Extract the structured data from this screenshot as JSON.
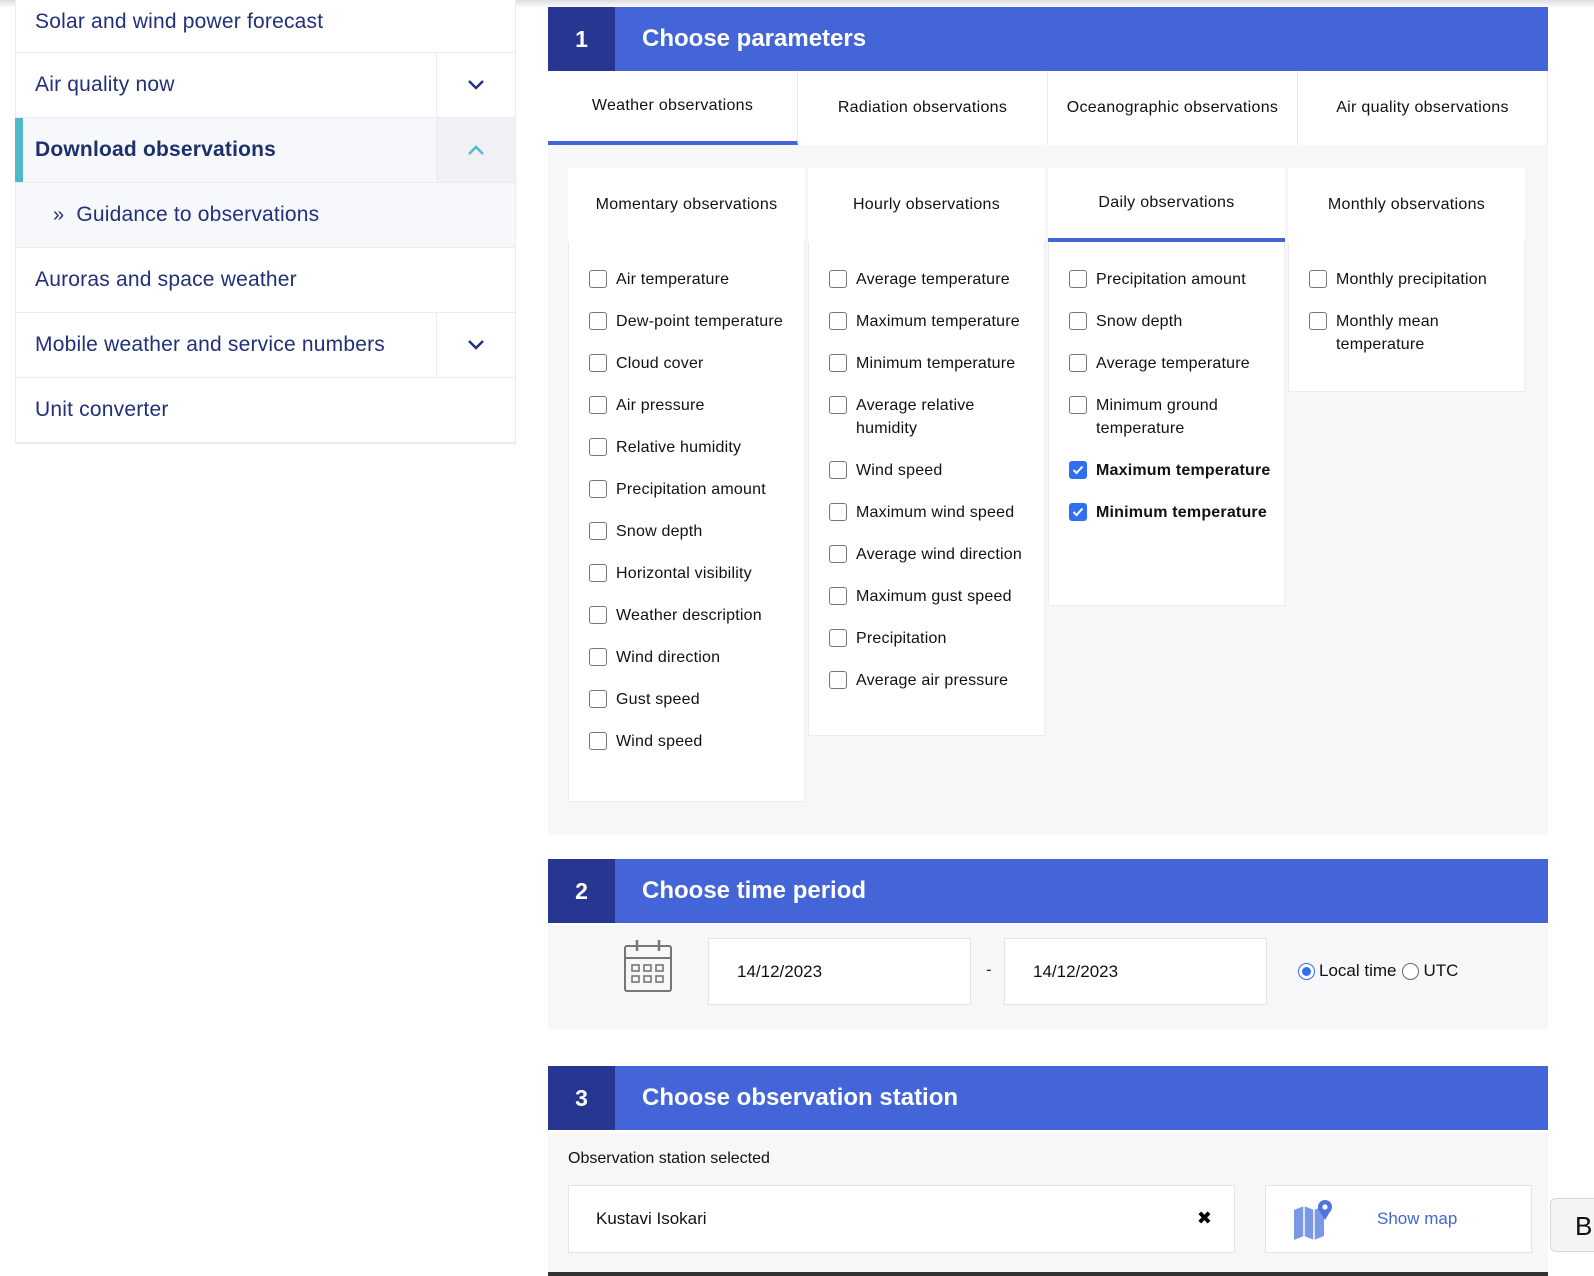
{
  "sidebar": {
    "items": [
      {
        "label": "Solar and wind power forecast"
      },
      {
        "label": "Air quality now"
      },
      {
        "label": "Download observations"
      },
      {
        "label": "Guidance to observations",
        "prefix": "»"
      },
      {
        "label": "Auroras and space weather"
      },
      {
        "label": "Mobile weather and service numbers"
      },
      {
        "label": "Unit converter"
      }
    ]
  },
  "section1": {
    "number": "1",
    "title": "Choose parameters",
    "tabs": [
      "Weather observations",
      "Radiation observations",
      "Oceanographic observations",
      "Air quality observations"
    ],
    "subtabs": [
      "Momentary observations",
      "Hourly observations",
      "Daily observations",
      "Monthly observations"
    ],
    "columns": [
      {
        "options": [
          {
            "label": "Air temperature",
            "checked": false
          },
          {
            "label": "Dew-point temperature",
            "checked": false
          },
          {
            "label": "Cloud cover",
            "checked": false
          },
          {
            "label": "Air pressure",
            "checked": false
          },
          {
            "label": "Relative humidity",
            "checked": false
          },
          {
            "label": "Precipitation amount",
            "checked": false
          },
          {
            "label": "Snow depth",
            "checked": false
          },
          {
            "label": "Horizontal visibility",
            "checked": false
          },
          {
            "label": "Weather description",
            "checked": false
          },
          {
            "label": "Wind direction",
            "checked": false
          },
          {
            "label": "Gust speed",
            "checked": false
          },
          {
            "label": "Wind speed",
            "checked": false
          }
        ]
      },
      {
        "options": [
          {
            "label": "Average temperature",
            "checked": false
          },
          {
            "label": "Maximum temperature",
            "checked": false
          },
          {
            "label": "Minimum temperature",
            "checked": false
          },
          {
            "label": "Average relative humidity",
            "checked": false
          },
          {
            "label": "Wind speed",
            "checked": false
          },
          {
            "label": "Maximum wind speed",
            "checked": false
          },
          {
            "label": "Average wind direction",
            "checked": false
          },
          {
            "label": "Maximum gust speed",
            "checked": false
          },
          {
            "label": "Precipitation",
            "checked": false
          },
          {
            "label": "Average air pressure",
            "checked": false
          }
        ]
      },
      {
        "options": [
          {
            "label": "Precipitation amount",
            "checked": false
          },
          {
            "label": "Snow depth",
            "checked": false
          },
          {
            "label": "Average temperature",
            "checked": false
          },
          {
            "label": "Minimum ground temperature",
            "checked": false
          },
          {
            "label": "Maximum temperature",
            "checked": true
          },
          {
            "label": "Minimum temperature",
            "checked": true
          }
        ]
      },
      {
        "options": [
          {
            "label": "Monthly precipitation",
            "checked": false
          },
          {
            "label": "Monthly mean temperature",
            "checked": false
          }
        ]
      }
    ]
  },
  "section2": {
    "number": "2",
    "title": "Choose time period",
    "start_date": "14/12/2023",
    "separator": "-",
    "end_date": "14/12/2023",
    "timezone_options": [
      "Local time",
      "UTC"
    ],
    "timezone_selected": "Local time",
    "icons": {
      "calendar": "calendar-icon"
    }
  },
  "section3": {
    "number": "3",
    "title": "Choose observation station",
    "selected_label": "Observation station selected",
    "station": "Kustavi Isokari",
    "clear": "✖",
    "map_button": "Show map",
    "icons": {
      "map": "map-pin-icon"
    }
  },
  "edge_button": {
    "label": "B"
  },
  "colors": {
    "header": "#4365d8",
    "header_num": "#263691",
    "accent": "#4fb8c9",
    "checkbox_on": "#2f6ff0"
  }
}
